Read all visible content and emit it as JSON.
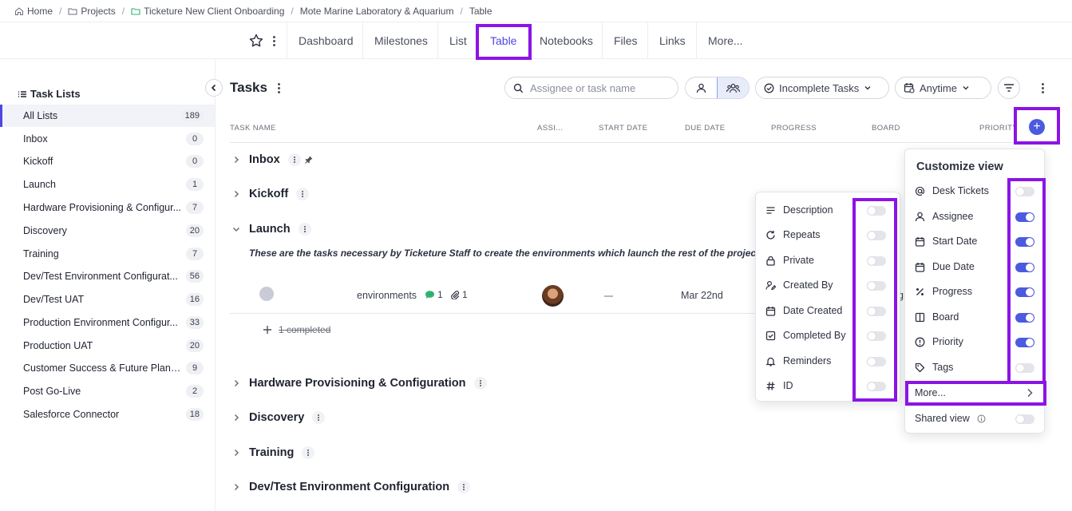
{
  "breadcrumb": {
    "items": [
      "Home",
      "Projects",
      "Ticketure New Client Onboarding",
      "Mote Marine Laboratory & Aquarium",
      "Table"
    ]
  },
  "nav": {
    "tabs": [
      "Dashboard",
      "Milestones",
      "List",
      "Table",
      "Notebooks",
      "Files",
      "Links",
      "More..."
    ],
    "active": "Table",
    "accent": "#4f46e5",
    "highlight_color": "#8b14e6"
  },
  "sidebar": {
    "title": "Task Lists",
    "items": [
      {
        "label": "All Lists",
        "count": "189"
      },
      {
        "label": "Inbox",
        "count": "0"
      },
      {
        "label": "Kickoff",
        "count": "0"
      },
      {
        "label": "Launch",
        "count": "1"
      },
      {
        "label": "Hardware Provisioning & Configur...",
        "count": "7"
      },
      {
        "label": "Discovery",
        "count": "20"
      },
      {
        "label": "Training",
        "count": "7"
      },
      {
        "label": "Dev/Test Environment Configurat...",
        "count": "56"
      },
      {
        "label": "Dev/Test UAT",
        "count": "16"
      },
      {
        "label": "Production Environment Configur...",
        "count": "33"
      },
      {
        "label": "Production UAT",
        "count": "20"
      },
      {
        "label": "Customer Success & Future Plann...",
        "count": "9"
      },
      {
        "label": "Post Go-Live",
        "count": "2"
      },
      {
        "label": "Salesforce Connector",
        "count": "18"
      }
    ]
  },
  "toolbar": {
    "title": "Tasks",
    "search_placeholder": "Assignee or task name",
    "filter_label": "Incomplete Tasks",
    "date_label": "Anytime"
  },
  "columns": [
    "TASK NAME",
    "ASSI...",
    "START DATE",
    "DUE DATE",
    "PROGRESS",
    "BOARD",
    "PRIORITY"
  ],
  "groups": {
    "inbox": "Inbox",
    "kickoff": "Kickoff",
    "launch": "Launch",
    "hardware": "Hardware Provisioning & Configuration",
    "discovery": "Discovery",
    "training": "Training",
    "devtest": "Dev/Test Environment Configuration"
  },
  "launch": {
    "description": "These are the tasks necessary by Ticketure Staff to create the environments which launch the rest of the project",
    "task": {
      "name": "environments",
      "comments": "1",
      "attachments": "1",
      "due_date": "Mar 22nd",
      "board_partial": "og"
    },
    "completed_label": "1 completed"
  },
  "more_menu": {
    "items": [
      {
        "label": "Description",
        "icon": "description-icon",
        "on": false
      },
      {
        "label": "Repeats",
        "icon": "repeat-icon",
        "on": false
      },
      {
        "label": "Private",
        "icon": "lock-icon",
        "on": false
      },
      {
        "label": "Created By",
        "icon": "user-edit-icon",
        "on": false
      },
      {
        "label": "Date Created",
        "icon": "calendar-icon",
        "on": false
      },
      {
        "label": "Completed By",
        "icon": "check-square-icon",
        "on": false
      },
      {
        "label": "Reminders",
        "icon": "bell-icon",
        "on": false
      },
      {
        "label": "ID",
        "icon": "hash-icon",
        "on": false
      }
    ]
  },
  "customize_view": {
    "title": "Customize view",
    "items": [
      {
        "label": "Desk Tickets",
        "icon": "at-icon",
        "on": false
      },
      {
        "label": "Assignee",
        "icon": "user-icon",
        "on": true
      },
      {
        "label": "Start Date",
        "icon": "calendar-start-icon",
        "on": true
      },
      {
        "label": "Due Date",
        "icon": "calendar-due-icon",
        "on": true
      },
      {
        "label": "Progress",
        "icon": "percent-icon",
        "on": true
      },
      {
        "label": "Board",
        "icon": "board-icon",
        "on": true
      },
      {
        "label": "Priority",
        "icon": "priority-icon",
        "on": true
      },
      {
        "label": "Tags",
        "icon": "tag-icon",
        "on": false
      }
    ],
    "more_label": "More...",
    "shared_label": "Shared view",
    "shared_on": false
  }
}
